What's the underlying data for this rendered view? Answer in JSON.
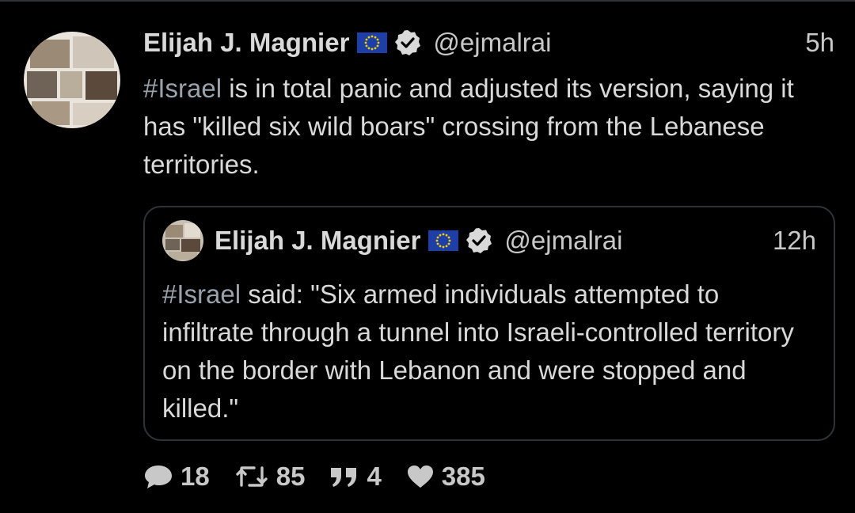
{
  "tweet": {
    "display_name": "Elijah J. Magnier",
    "flag_icon": "eu-flag-icon",
    "verified_icon": "verified-badge-icon",
    "handle": "@ejmalrai",
    "time": "5h",
    "text_hashtag": "#Israel",
    "text_body": " is in total panic and adjusted its version, saying it has \"killed six wild boars\" crossing from the Lebanese territories."
  },
  "quoted_tweet": {
    "display_name": "Elijah J. Magnier",
    "flag_icon": "eu-flag-icon",
    "verified_icon": "verified-badge-icon",
    "handle": "@ejmalrai",
    "time": "12h",
    "text_hashtag": "#Israel",
    "text_body": " said: \"Six armed individuals attempted to infiltrate through a tunnel into Israeli-controlled territory on the border with Lebanon and were stopped and killed.\""
  },
  "actions": {
    "replies": "18",
    "retweets": "85",
    "quotes": "4",
    "likes": "385"
  },
  "colors": {
    "background": "#000000",
    "text": "#d9d9d9",
    "muted": "#c8c8c8",
    "hashtag": "#9aa3ad",
    "verified": "#d9d9d9",
    "eu_blue": "#1f3fa8",
    "eu_star": "#f5d000"
  }
}
